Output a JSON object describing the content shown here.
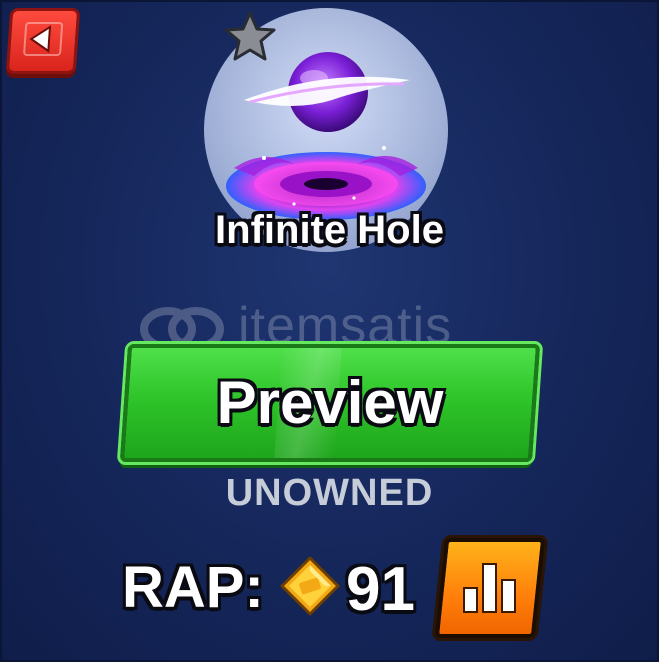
{
  "item": {
    "name": "Infinite Hole",
    "status": "UNOWNED"
  },
  "actions": {
    "preview_label": "Preview"
  },
  "rap": {
    "label": "RAP:",
    "value": "91"
  },
  "watermark": {
    "text": "itemsatis"
  },
  "icons": {
    "back": "back-arrow-icon",
    "star": "star-icon",
    "coin": "diamond-coin-icon",
    "chart": "bar-chart-icon"
  },
  "colors": {
    "background": "#15265a",
    "back_button": "#e02c22",
    "preview_button": "#2fc52a",
    "chart_button": "#ff8a0f",
    "status_text": "#c7cdd8"
  }
}
